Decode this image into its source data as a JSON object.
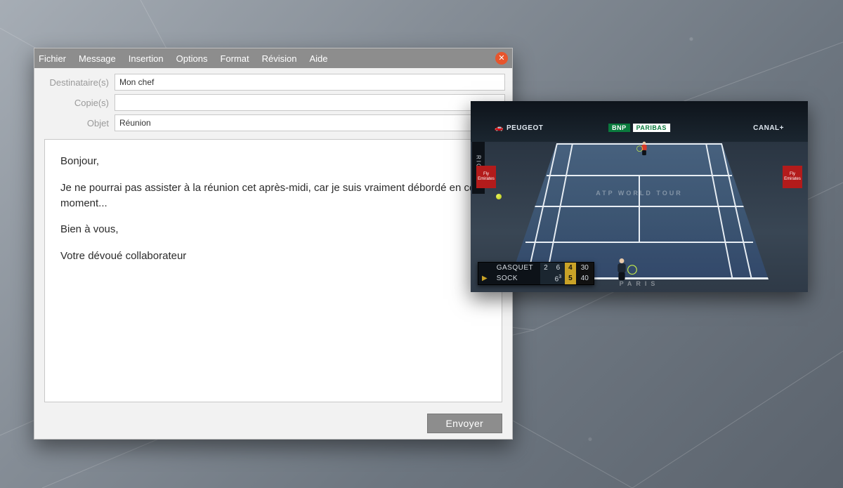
{
  "menu": {
    "file": "Fichier",
    "message": "Message",
    "insert": "Insertion",
    "options": "Options",
    "format": "Format",
    "review": "Révision",
    "help": "Aide"
  },
  "fields": {
    "to_label": "Destinataire(s)",
    "cc_label": "Copie(s)",
    "subject_label": "Objet",
    "to_value": "Mon chef",
    "cc_value": "",
    "subject_value": "Réunion"
  },
  "body": {
    "p1": "Bonjour,",
    "p2": "Je ne pourrai pas assister à la réunion cet après-midi, car je suis vraiment débordé en ce moment...",
    "p3": "Bien à vous,",
    "p4": "Votre dévoué collaborateur"
  },
  "actions": {
    "send": "Envoyer"
  },
  "pip": {
    "sponsor_left": "PEUGEOT",
    "sponsor_center_a": "BNP",
    "sponsor_center_b": "PARIBAS",
    "sponsor_right": "CANAL+",
    "side_brand": "RICOH",
    "banner_text": "Fly Emirates",
    "tour_text": "ATP WORLD TOUR",
    "city_text": "PARIS",
    "score": {
      "p1": {
        "name": "GASQUET",
        "serving": false,
        "set1": "2",
        "set2": "6",
        "cur": "4",
        "pts": "30"
      },
      "p2": {
        "name": "SOCK",
        "serving": true,
        "set1": "",
        "set2": "6",
        "cur": "5",
        "pts": "40"
      },
      "set1_super": "3"
    }
  }
}
